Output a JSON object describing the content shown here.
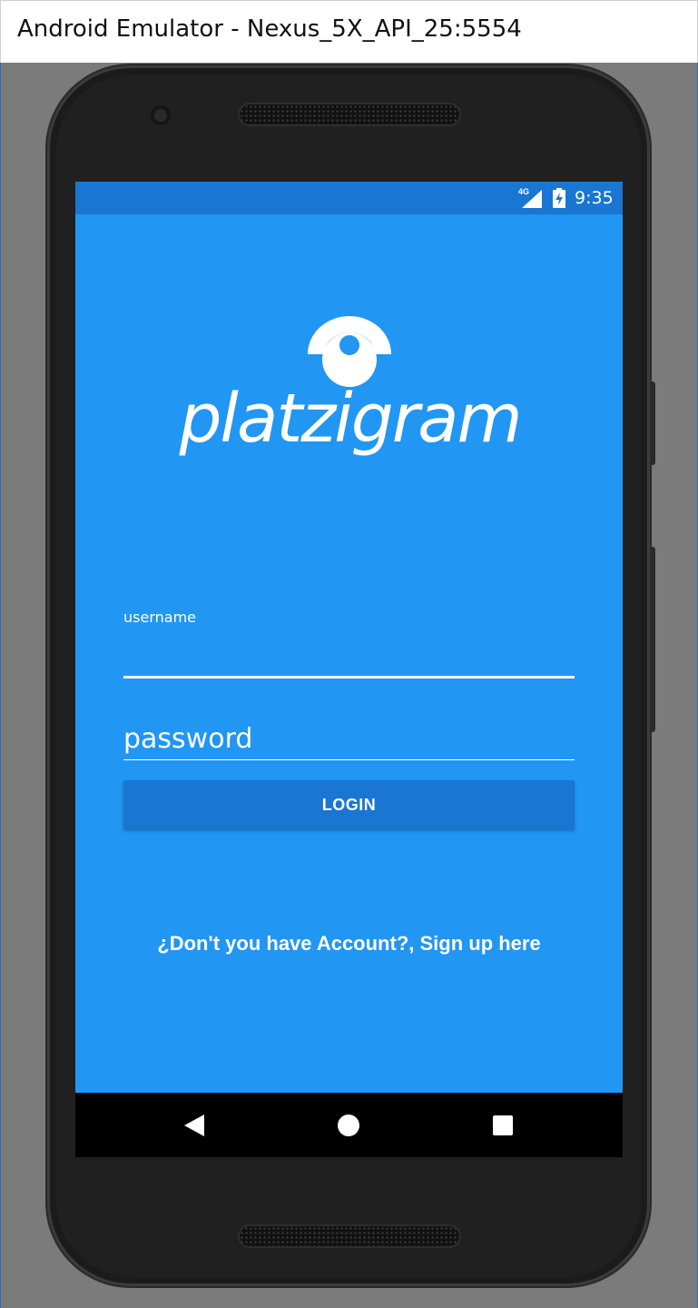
{
  "window": {
    "title": "Android Emulator - Nexus_5X_API_25:5554"
  },
  "status_bar": {
    "network": "4G",
    "time": "9:35",
    "background": "#1976d2"
  },
  "app": {
    "logo_text": "platzigram",
    "background": "#2196f3",
    "username_label": "username",
    "username_value": "",
    "password_placeholder": "password",
    "login_label": "LOGIN",
    "signup_text": "¿Don't you have Account?, Sign up here"
  },
  "nav_bar": {
    "icons": [
      "back-icon",
      "home-icon",
      "recents-icon"
    ]
  }
}
